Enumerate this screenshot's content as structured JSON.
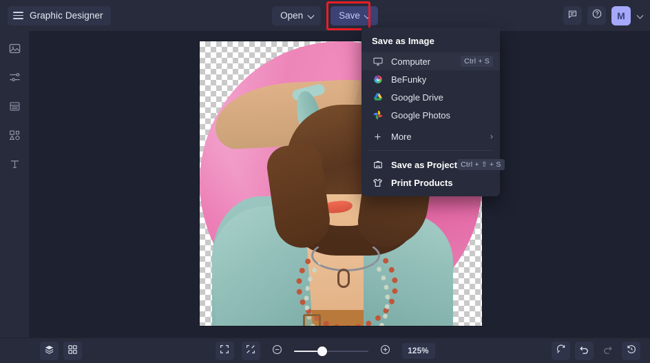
{
  "app": {
    "brand_label": "Graphic Designer",
    "menu_icon": "hamburger-icon"
  },
  "topbar": {
    "open_label": "Open",
    "save_label": "Save",
    "chevron_icon": "chevron-down-icon",
    "feedback_icon": "comment-icon",
    "help_icon": "question-circle-icon",
    "avatar_initial": "M",
    "avatar_color": "#a5a8fb",
    "save_button_color": "#3c4273",
    "save_highlight_color": "#ee1c25"
  },
  "save_menu": {
    "title": "Save as Image",
    "items": [
      {
        "label": "Computer",
        "shortcut": "Ctrl + S",
        "icon": "monitor-icon",
        "bold": false,
        "hovered": true,
        "submenu": false
      },
      {
        "label": "BeFunky",
        "shortcut": "",
        "icon": "befunky-logo-icon",
        "bold": false,
        "hovered": false,
        "submenu": false
      },
      {
        "label": "Google Drive",
        "shortcut": "",
        "icon": "google-drive-icon",
        "bold": false,
        "hovered": false,
        "submenu": false
      },
      {
        "label": "Google Photos",
        "shortcut": "",
        "icon": "google-photos-icon",
        "bold": false,
        "hovered": false,
        "submenu": false
      },
      {
        "label": "More",
        "shortcut": "",
        "icon": "plus-icon",
        "bold": false,
        "hovered": false,
        "submenu": true
      }
    ],
    "footer_items": [
      {
        "label": "Save as Project",
        "shortcut": "Ctrl + ⇧ + S",
        "icon": "briefcase-save-icon",
        "bold": true
      },
      {
        "label": "Print Products",
        "shortcut": "",
        "icon": "tshirt-icon",
        "bold": true
      }
    ],
    "submenu_arrow": "›"
  },
  "left_rail": {
    "items": [
      {
        "name": "image-tool",
        "icon": "image-icon"
      },
      {
        "name": "edit-tool",
        "icon": "sliders-icon"
      },
      {
        "name": "texture-tool",
        "icon": "layers-lines-icon"
      },
      {
        "name": "graphic-tool",
        "icon": "shapes-icon"
      },
      {
        "name": "text-tool",
        "icon": "text-t-icon"
      }
    ]
  },
  "canvas": {
    "artwork_description": "Illustration of a woman with short brown hair, teal shirt and beaded necklaces on a pink circular background",
    "transparent_background": true,
    "pink_circle_color": "#e96ba9",
    "shirt_color": "#8cbcb6",
    "skin_color": "#e6b789",
    "hair_color": "#5a3620"
  },
  "bottombar": {
    "left_items": [
      {
        "name": "layers-button",
        "icon": "layers-stack-icon"
      },
      {
        "name": "thumbnails-button",
        "icon": "grid-four-squares-icon"
      }
    ],
    "center_items": [
      {
        "name": "fit-screen-button",
        "icon": "expand-corners-icon"
      },
      {
        "name": "actual-size-button",
        "icon": "collapse-arrows-icon"
      },
      {
        "name": "zoom-out-button",
        "icon": "minus-circle-icon"
      },
      {
        "name": "zoom-slider",
        "icon": "slider-icon"
      },
      {
        "name": "zoom-in-button",
        "icon": "plus-circle-icon"
      }
    ],
    "zoom_level": "125%",
    "zoom_slider_percent": 38,
    "right_items": [
      {
        "name": "reset-button",
        "icon": "refresh-icon",
        "enabled": true
      },
      {
        "name": "undo-button",
        "icon": "undo-arrow-icon",
        "enabled": true
      },
      {
        "name": "redo-button",
        "icon": "redo-arrow-icon",
        "enabled": false
      },
      {
        "name": "history-button",
        "icon": "clock-history-icon",
        "enabled": true
      }
    ]
  }
}
